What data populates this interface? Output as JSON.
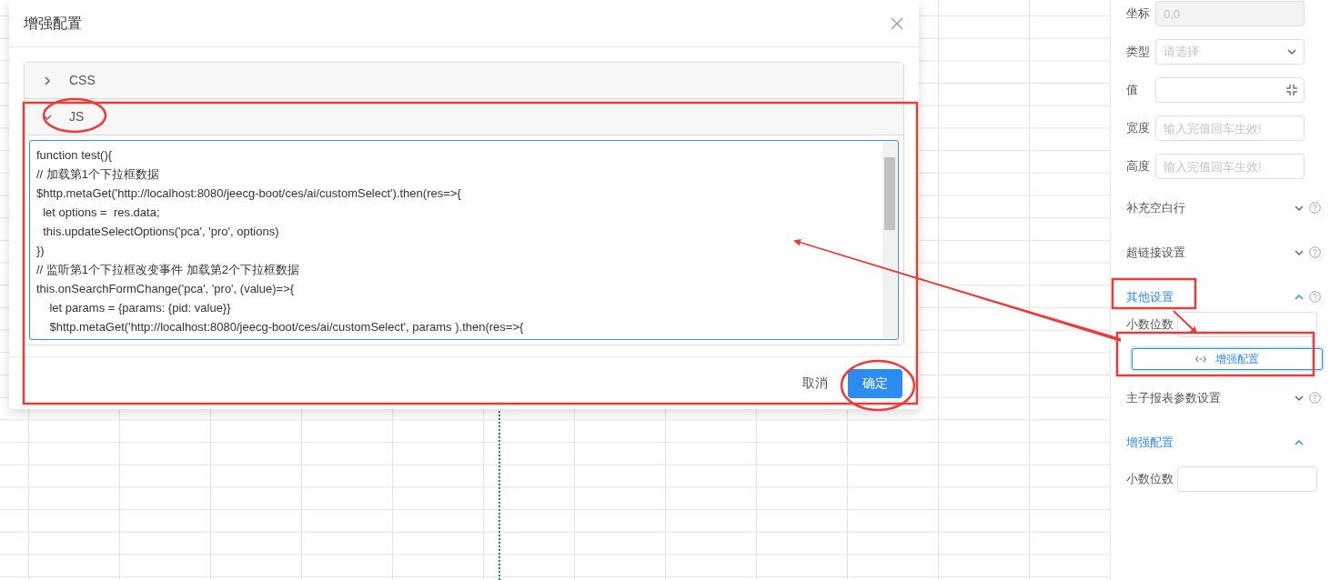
{
  "dialog": {
    "title": "增强配置",
    "panels": [
      {
        "title": "CSS",
        "expanded": false
      },
      {
        "title": "JS",
        "expanded": true,
        "code_lines": [
          "function test(){",
          "// 加载第1个下拉框数据",
          "$http.metaGet('http://localhost:8080/jeecg-boot/ces/ai/customSelect').then(res=>{",
          "  let options =  res.data;",
          "  this.updateSelectOptions('pca', 'pro', options)",
          "})",
          "// 监听第1个下拉框改变事件 加载第2个下拉框数据",
          "this.onSearchFormChange('pca', 'pro', (value)=>{",
          "    let params = {params: {pid: value}}",
          "    $http.metaGet('http://localhost:8080/jeecg-boot/ces/ai/customSelect', params ).then(res=>{"
        ]
      }
    ],
    "buttons": [
      {
        "label": "取消",
        "kind": "default"
      },
      {
        "label": "确定",
        "kind": "primary"
      }
    ]
  },
  "properties": {
    "fields": [
      {
        "label": "坐标",
        "kind": "input",
        "value": "0,0",
        "disabled": true
      },
      {
        "label": "类型",
        "kind": "select",
        "placeholder": "请选择",
        "disabled": false
      },
      {
        "label": "值",
        "kind": "expand",
        "disabled": false
      },
      {
        "label": "宽度",
        "kind": "input",
        "placeholder": "输入完值回车生效!",
        "disabled": false
      },
      {
        "label": "高度",
        "kind": "input",
        "placeholder": "输入完值回车生效!",
        "disabled": false
      }
    ],
    "sections": [
      {
        "title": "补充空白行",
        "expanded": false,
        "help": true
      },
      {
        "title": "超链接设置",
        "expanded": false,
        "help": true
      },
      {
        "title": "其他设置",
        "expanded": true,
        "help": true,
        "fields": [
          {
            "label": "小数位数"
          }
        ],
        "button": "增强配置"
      },
      {
        "title": "主子报表参数设置",
        "expanded": false,
        "help": true
      },
      {
        "title": "增强配置",
        "expanded": true,
        "help": false,
        "fields": [
          {
            "label": "小数位数"
          }
        ]
      }
    ]
  }
}
